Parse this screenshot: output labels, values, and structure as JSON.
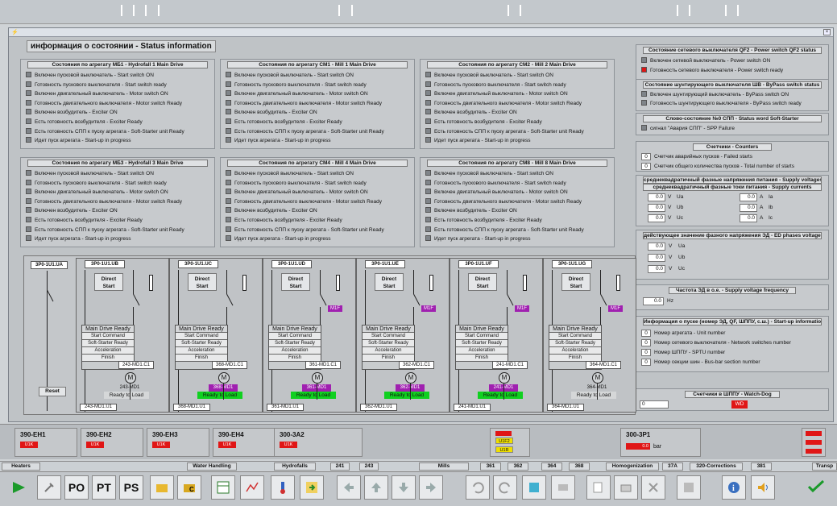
{
  "window": {
    "title": "информация о состоянии - Status information",
    "close_label": "×"
  },
  "drives": [
    {
      "title": "Состояния по агрегату МБ1 - Hydrofall 1 Main Drive"
    },
    {
      "title": "Состояния по агрегату СМ1 - Mill 1 Main Drive"
    },
    {
      "title": "Состояния по агрегату СМ2 - Mill 2 Main Drive"
    },
    {
      "title": "Состояния по агрегату МБ3 - Hydrofall 3 Main Drive"
    },
    {
      "title": "Состояния по агрегату СМ4 - Mill 4 Main Drive"
    },
    {
      "title": "Состояния по агрегату СМ8 - Mill 8 Main Drive"
    }
  ],
  "drive_rows": [
    "Включен пусковой выключатель - Start switch ON",
    "Готовность пускового выключателя - Start switch ready",
    "Включен двигательный выключатель - Motor switch ON",
    "Готовность двигательного выключателя - Motor switch Ready",
    "Включен возбудитель - Exciter ON",
    "Есть готовность возбудителя - Exciter Ready",
    "Есть готовность СПП к пуску агрегата - Soft-Starter unit Ready",
    "Идет пуск агрегата - Start-up in progress"
  ],
  "qf2": {
    "title": "Состояние сетевого выключателя QF2 - Power switch QF2 status",
    "rows": [
      "Включен сетевой выключатель - Power switch ON",
      "Готовность сетевого выключателя - Power switch ready"
    ]
  },
  "bypass": {
    "title": "Состояние шунтирующего выключателя ШВ - ByPass switch status",
    "rows": [
      "Включен шунтирующий выключатель - ByPass switch ON",
      "Готовность шунтирующего выключателя - ByPass switch ready"
    ]
  },
  "status_word": {
    "title": "Слово-состояние №0 СПП - Status word Soft-Starter",
    "row": "сигнал \"Авария СПП\" - SPP Failure"
  },
  "counters": {
    "title": "Счетчики - Counters",
    "rows": [
      {
        "value": "0",
        "label": "Счетчик аварийных пусков - Failed starts"
      },
      {
        "value": "0",
        "label": "Счетчик общего количества пусков - Total number of starts"
      }
    ]
  },
  "supply": {
    "title1": "среднеквадратичный фазные напряжения питания - Supply voltages",
    "title2": "среднеквадратичный фазные токи питания - Supply currents",
    "volt": [
      {
        "value": "0.0",
        "unit": "V",
        "label": "Ua"
      },
      {
        "value": "0.0",
        "unit": "V",
        "label": "Ub"
      },
      {
        "value": "0.0",
        "unit": "V",
        "label": "Uc"
      }
    ],
    "amp": [
      {
        "value": "0.0",
        "unit": "A",
        "label": "Ia"
      },
      {
        "value": "0.0",
        "unit": "A",
        "label": "Ib"
      },
      {
        "value": "0.0",
        "unit": "A",
        "label": "Ic"
      }
    ]
  },
  "ed_phases": {
    "title": "действующее значение фазного напряжения ЭД - ED phases voltages",
    "rows": [
      {
        "value": "0.0",
        "unit": "V",
        "label": "Ua"
      },
      {
        "value": "0.0",
        "unit": "V",
        "label": "Ub"
      },
      {
        "value": "0.0",
        "unit": "V",
        "label": "Uc"
      }
    ]
  },
  "freq": {
    "title": "Частота ЭД в о.е. - Supply voltage frequency",
    "value": "0.0",
    "unit": "Hz"
  },
  "startup": {
    "title": "Информация о пуске (номер ЭД, QF, ШППУ, с.ш.) - Start-up information",
    "rows": [
      {
        "value": "0",
        "label": "Номер агрегата - Unit number"
      },
      {
        "value": "0",
        "label": "Номер сетевого выключателя - Network switches number"
      },
      {
        "value": "0",
        "label": "Номер ШППУ - SPTU number"
      },
      {
        "value": "0",
        "label": "Номер секции шин - Bus-bar section number"
      }
    ]
  },
  "watchdog": {
    "title": "Счетчики в ШППУ - Watch-Dog",
    "value": "0",
    "wd": "WD"
  },
  "scheme": {
    "reset_label": "Reset",
    "first_tag": "3P0-1U1.UA",
    "cells": [
      {
        "tag": "3P0-1U1.UB",
        "direct": "Direct Start",
        "motor_tag": "243-MD1",
        "c1": "243-MD1.C1",
        "status": "Ready to Load",
        "u1": "243-MD1.U1",
        "m1f": "",
        "active": false
      },
      {
        "tag": "3P0-1U1.UC",
        "direct": "Direct Start",
        "motor_tag": "368-MD1",
        "c1": "368-MD1.C1",
        "status": "Ready to Load",
        "u1": "368-MD1.U1",
        "m1f": "",
        "active": true
      },
      {
        "tag": "3P0-1U1.UD",
        "direct": "Direct Start",
        "motor_tag": "361-MD1",
        "c1": "361-MD1.C1",
        "status": "Ready to Load",
        "u1": "361-MD1.U1",
        "m1f": "M1F",
        "active": true
      },
      {
        "tag": "3P0-1U1.UE",
        "direct": "Direct Start",
        "motor_tag": "362-MD1",
        "c1": "362-MD1.C1",
        "status": "Ready to Load",
        "u1": "362-MD1.U1",
        "m1f": "M1F",
        "active": true
      },
      {
        "tag": "3P0-1U1.UF",
        "direct": "Direct Start",
        "motor_tag": "241-MD1",
        "c1": "241-MD1.C1",
        "status": "Ready to Load",
        "u1": "241-MD1.U1",
        "m1f": "M1F",
        "active": true
      },
      {
        "tag": "3P0-1U1.UG",
        "direct": "Direct Start",
        "motor_tag": "364-MD1",
        "c1": "364-MD1.C1",
        "status": "Ready to Load",
        "u1": "364-MD1.U1",
        "m1f": "M1F",
        "active": false
      }
    ],
    "mdr_rows": [
      "Main Drive Ready",
      "Start Command",
      "Soft-Starter Ready",
      "Acceleration",
      "Finish"
    ]
  },
  "bottom": {
    "heaters": [
      {
        "title": "390-EH1",
        "tag": "U1K"
      },
      {
        "title": "390-EH2",
        "tag": "U1K"
      },
      {
        "title": "390-EH3",
        "tag": "U1K"
      },
      {
        "title": "390-EH4",
        "tag": "U1K"
      }
    ],
    "sa2": {
      "title": "300-3A2",
      "tag": "U1K"
    },
    "u1f2": "U1F2",
    "u1r": "U1R",
    "sp1": {
      "title": "300-3P1",
      "value": "0.0",
      "unit": "bar"
    }
  },
  "nav": {
    "heaters": "Heaters",
    "water": "Water Handling",
    "hydrofalls": "Hydrofalls",
    "h241": "241",
    "h243": "243",
    "mills": "Mills",
    "m361": "361",
    "m362": "362",
    "m364": "364",
    "m368": "368",
    "homog": "Homogenization",
    "n37a": "37A",
    "corr": "320-Corrections",
    "n381": "381",
    "transp": "Transp"
  },
  "toolbar": {
    "po": "PO",
    "pt": "PT",
    "ps": "PS"
  },
  "colors": {
    "red": "#e01616",
    "green": "#10d020",
    "purple": "#a020b0",
    "yellow": "#f0e000"
  }
}
